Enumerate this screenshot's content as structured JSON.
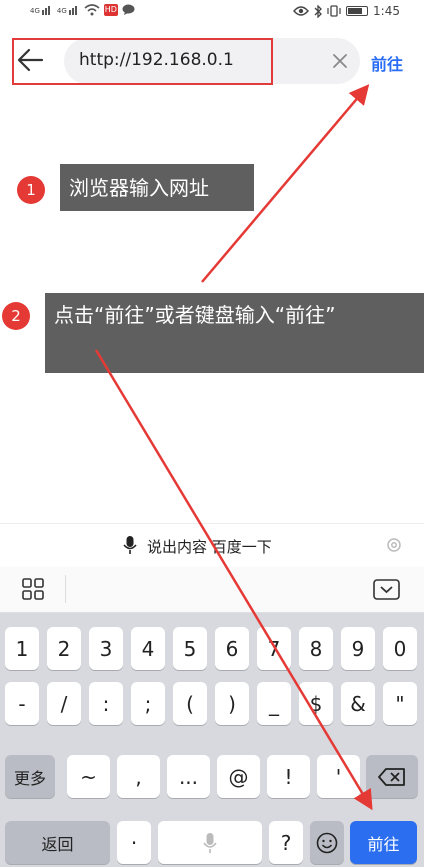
{
  "status_bar": {
    "time": "1:45",
    "hw_badge": "HD"
  },
  "address_bar": {
    "url": "http://192.168.0.1",
    "go_label": "前往"
  },
  "annotations": {
    "step1": {
      "number": "1",
      "text": "浏览器输入网址"
    },
    "step2": {
      "number": "2",
      "text": "点击“前往”或者键盘输入“前往”"
    },
    "color": "#e53935"
  },
  "voice_bar": {
    "text": "说出内容 百度一下"
  },
  "keyboard": {
    "row1": [
      "1",
      "2",
      "3",
      "4",
      "5",
      "6",
      "7",
      "8",
      "9",
      "0"
    ],
    "row2": [
      "-",
      "/",
      ":",
      ";",
      "(",
      ")",
      "_",
      "$",
      "&",
      "\""
    ],
    "row3": [
      "~",
      ",",
      "...",
      "@",
      "!",
      "'"
    ],
    "more_label": "更多",
    "back_label": "返回",
    "dot_label": "·",
    "question_label": "?",
    "go_label": "前往"
  },
  "colors": {
    "accent": "#2b6ff0",
    "highlight": "#e23b3b",
    "tooltip": "#5f5f5f"
  }
}
